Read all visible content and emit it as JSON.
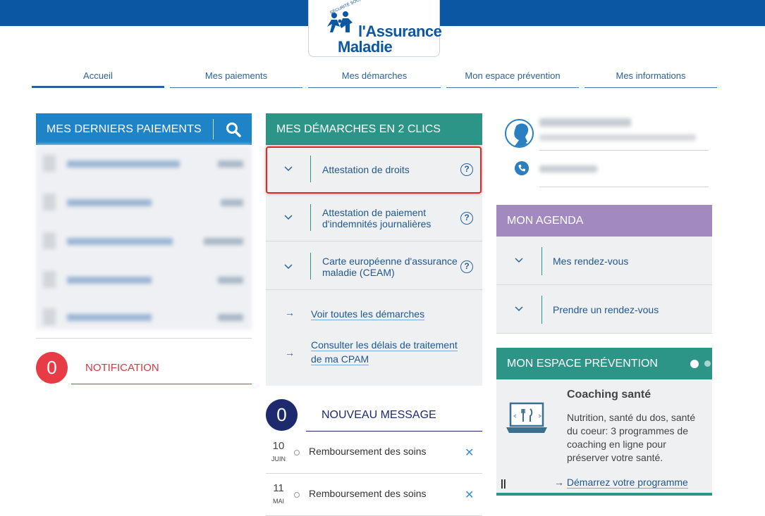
{
  "brand": {
    "small_text": "SÉCURITÉ SOCIALE",
    "line1": "l'Assurance",
    "line2": "Maladie",
    "logo_icon": "family-figures-logo",
    "primary_color": "#0c57a4"
  },
  "nav": {
    "items": [
      {
        "label": "Accueil",
        "active": true
      },
      {
        "label": "Mes paiements"
      },
      {
        "label": "Mes démarches"
      },
      {
        "label": "Mon espace prévention"
      },
      {
        "label": "Mes informations"
      }
    ]
  },
  "payments": {
    "title": "MES DERNIERS PAIEMENTS",
    "search_icon": "search-icon",
    "color": "#1e83c7"
  },
  "notification": {
    "count": "0",
    "label": "NOTIFICATION",
    "color": "#e73b46"
  },
  "demarches": {
    "title": "MES DÉMARCHES EN 2 CLICS",
    "color": "#2d9488",
    "items": [
      {
        "line1": "Attestation de droits",
        "line2": ""
      },
      {
        "line1": "Attestation de paiement",
        "line2": "d'indemnités journalières"
      },
      {
        "line1": "Carte européenne d'assurance",
        "line2": "maladie (CEAM)"
      }
    ],
    "help_glyph": "?",
    "links": [
      {
        "line1": "Voir toutes les démarches",
        "line2": ""
      },
      {
        "line1": "Consulter les délais de traitement",
        "line2": "de ma CPAM"
      }
    ],
    "arrow_glyph": "→"
  },
  "messages": {
    "count": "0",
    "label": "NOUVEAU MESSAGE",
    "rows": [
      {
        "day": "10",
        "month": "JUIN",
        "text": "Remboursement des soins"
      },
      {
        "day": "11",
        "month": "MAI",
        "text": "Remboursement des soins"
      }
    ],
    "close_glyph": "✕"
  },
  "agenda": {
    "title": "MON AGENDA",
    "color": "#a28ac1",
    "items": [
      {
        "label": "Mes rendez-vous"
      },
      {
        "label": "Prendre un rendez-vous"
      }
    ]
  },
  "prevention": {
    "title": "MON ESPACE PRÉVENTION",
    "card_title": "Coaching santé",
    "card_desc": "Nutrition, santé du dos, santé du coeur: 3 programmes de coaching en ligne pour préserver votre santé.",
    "pause_glyph": "||",
    "link_arrow": "→",
    "link_label": "Démarrez votre programme"
  }
}
